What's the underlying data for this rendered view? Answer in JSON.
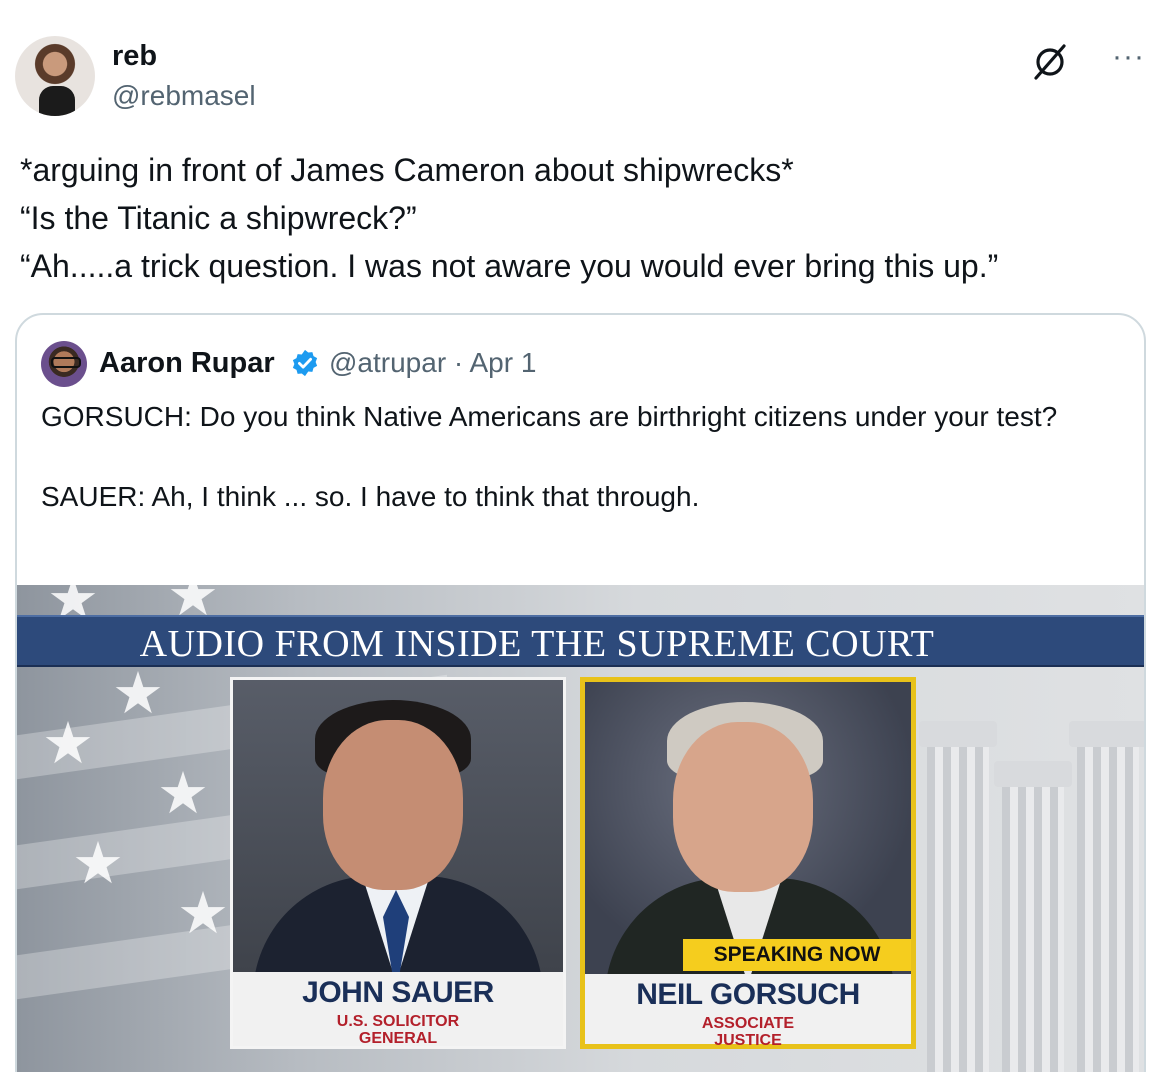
{
  "author": {
    "name": "reb",
    "handle": "@rebmasel"
  },
  "icons": {
    "grok": "grok-icon",
    "more": "more-options-icon",
    "verified": "verified-badge-icon"
  },
  "tweet": {
    "lines": [
      "*arguing in front of James Cameron about shipwrecks*",
      "“Is the Titanic a shipwreck?”",
      "“Ah.....a trick question. I was not aware you would ever bring this up.”"
    ]
  },
  "quoted_tweet": {
    "name": "Aaron Rupar",
    "handle": "@atrupar",
    "date": "Apr 1",
    "paragraphs": [
      "GORSUCH: Do you think Native Americans are birthright citizens under your test?",
      "SAUER: Ah, I think ... so. I have to think that through."
    ],
    "media": {
      "banner": "AUDIO FROM INSIDE THE SUPREME COURT",
      "left_card": {
        "name": "JOHN SAUER",
        "title_line1": "U.S. SOLICITOR",
        "title_line2": "GENERAL"
      },
      "right_card": {
        "speaking_label": "SPEAKING NOW",
        "name": "NEIL GORSUCH",
        "title_line1": "ASSOCIATE",
        "title_line2": "JUSTICE"
      }
    }
  },
  "colors": {
    "verified": "#1d9bf0",
    "banner": "#2d4a7b",
    "highlight": "#e8c21a"
  }
}
